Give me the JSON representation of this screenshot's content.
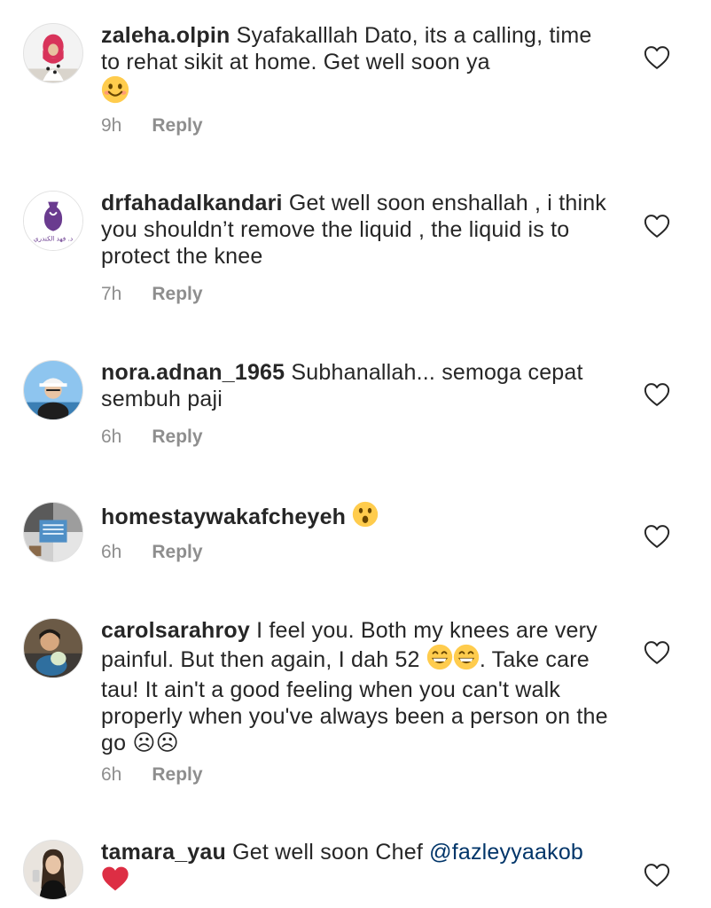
{
  "comments": [
    {
      "username": "zaleha.olpin",
      "text": "Syafakalllah Dato, its a calling, time to rehat sikit at home. Get well soon ya",
      "time": "9h",
      "reply_label": "Reply"
    },
    {
      "username": "drfahadalkandari",
      "text": "Get well soon enshallah , i think you shouldn’t remove the liquid , the liquid is to protect the knee",
      "time": "7h",
      "reply_label": "Reply",
      "avatar_text": "د. فهد الكندري"
    },
    {
      "username": "nora.adnan_1965",
      "text": "Subhanallah... semoga cepat sembuh paji",
      "time": "6h",
      "reply_label": "Reply"
    },
    {
      "username": "homestaywakafcheyeh",
      "text": "",
      "time": "6h",
      "reply_label": "Reply"
    },
    {
      "username": "carolsarahroy",
      "text_a": "I feel you. Both my knees are very painful. But then again, I dah 52",
      "text_b": ". Take care tau! It ain't a good feeling when you can't walk properly when you've always been a person on the go ☹☹",
      "time": "6h",
      "reply_label": "Reply"
    },
    {
      "username": "tamara_yau",
      "text": "Get well soon Chef",
      "mention": "@fazleyyaakob"
    }
  ],
  "icons": {
    "like": "heart-outline-icon",
    "emoji_smile": "smiling-face-icon",
    "emoji_surprised": "surprised-face-icon",
    "emoji_grin": "grinning-face-icon",
    "emoji_heart": "red-heart-icon"
  },
  "colors": {
    "text": "#262626",
    "meta": "#8e8e8e",
    "mention": "#003569",
    "emoji_yellow": "#ffcc4d",
    "heart_red": "#dd2e44"
  }
}
